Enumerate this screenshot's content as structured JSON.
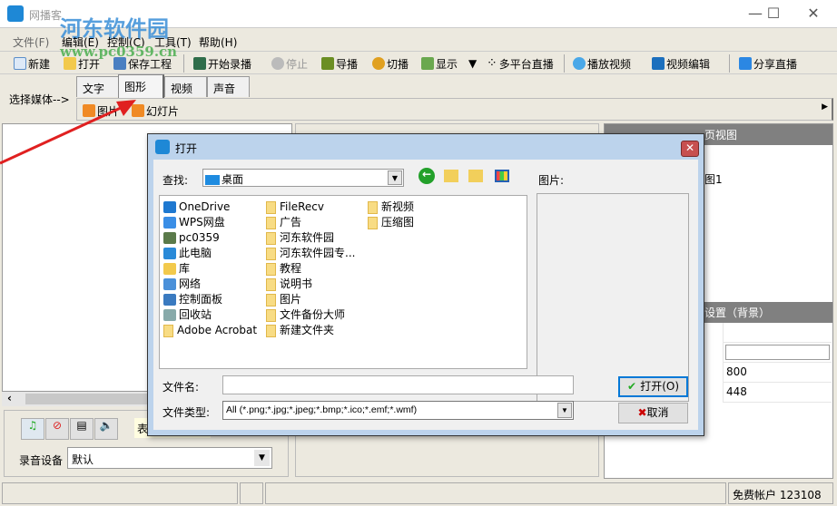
{
  "window": {
    "title": "网播客"
  },
  "watermark": {
    "name": "河东软件园",
    "url": "www.pc0359.cn"
  },
  "menu": [
    "文件(F)",
    "编辑(E)",
    "控制(C)",
    "工具(T)",
    "帮助(H)"
  ],
  "toolbar": {
    "new": "新建",
    "open": "打开",
    "save": "保存工程",
    "start_record": "开始录播",
    "stop": "停止",
    "direct": "导播",
    "switch": "切播",
    "display": "显示",
    "multi_platform": "多平台直播",
    "play_video": "播放视频",
    "video_edit": "视频编辑",
    "share_live": "分享直播"
  },
  "media": {
    "label": "选择媒体-->",
    "tabs": [
      "文字",
      "图形",
      "视频",
      "声音"
    ],
    "selected_tab": "图形",
    "sub_items": [
      "图片",
      "幻灯片"
    ]
  },
  "right_panel": {
    "view_header": "页视图",
    "view_item": "图1",
    "settings_header": "设置（背景）",
    "values": [
      "800",
      "448"
    ]
  },
  "bottom_panel": {
    "partial_text": "表",
    "device_label": "录音设备",
    "device_value": "默认"
  },
  "status": {
    "account": "免费帐户 123108"
  },
  "dialog": {
    "title": "打开",
    "lookin_label": "查找:",
    "lookin_value": "桌面",
    "preview_label": "图片:",
    "col1": [
      "OneDrive",
      "WPS网盘",
      "pc0359",
      "此电脑",
      "库",
      "网络",
      "控制面板",
      "回收站",
      "Adobe Acrobat"
    ],
    "col2": [
      "FileRecv",
      "广告",
      "河东软件园",
      "河东软件园专...",
      "教程",
      "说明书",
      "图片",
      "文件备份大师",
      "新建文件夹"
    ],
    "col3": [
      "新视频",
      "压缩图"
    ],
    "filename_label": "文件名:",
    "filename_value": "",
    "filetype_label": "文件类型:",
    "filetype_value": "All (*.png;*.jpg;*.jpeg;*.bmp;*.ico;*.emf;*.wmf)",
    "open_button": "打开(O)",
    "cancel_button": "取消"
  },
  "colors": {
    "accent": "#0078d7",
    "header_gray": "#808080"
  }
}
